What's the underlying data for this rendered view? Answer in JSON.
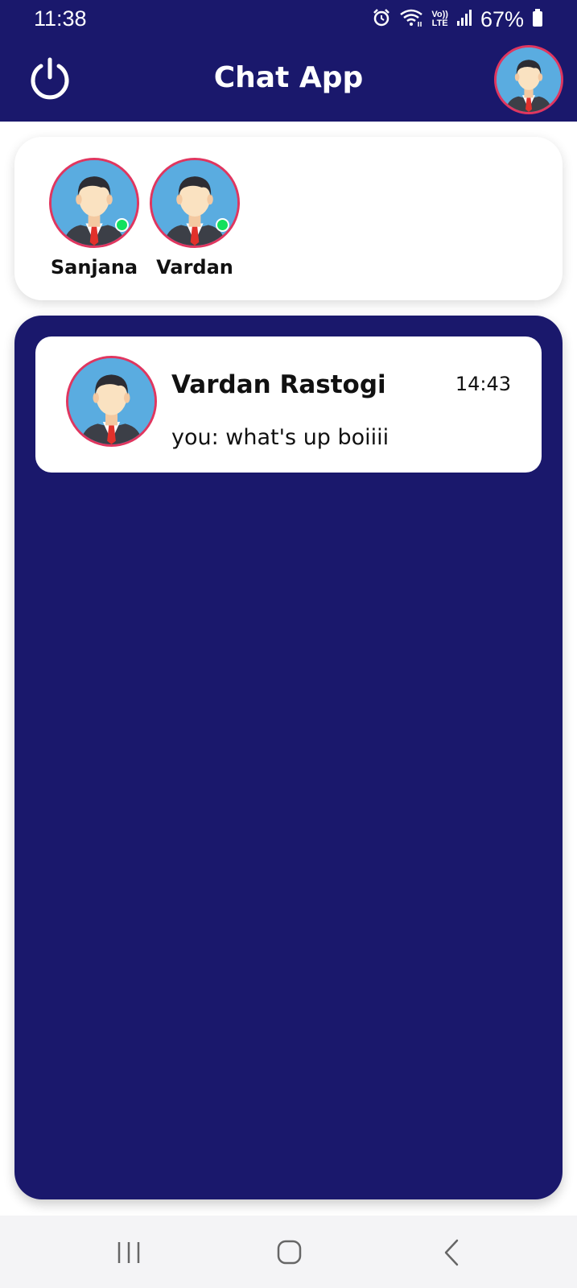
{
  "status_bar": {
    "time": "11:38",
    "battery_percent": "67%",
    "icons": [
      "alarm-icon",
      "wifi-icon",
      "volte-icon",
      "signal-icon",
      "battery-icon"
    ],
    "volte_label_top": "Vo))",
    "volte_label_bottom": "LTE"
  },
  "app_bar": {
    "title": "Chat App",
    "left_icon": "power-icon",
    "right_icon": "profile-avatar"
  },
  "online_users": [
    {
      "name": "Sanjana",
      "online": true
    },
    {
      "name": "Vardan",
      "online": true
    }
  ],
  "chats": [
    {
      "name": "Vardan Rastogi",
      "time": "14:43",
      "last_message": "you: what's up boiiii"
    }
  ],
  "nav_bar": {
    "buttons": [
      "recent-apps-icon",
      "home-icon",
      "back-icon"
    ]
  },
  "colors": {
    "primary": "#1a186c",
    "avatar_border": "#e0365f",
    "avatar_bg": "#5aace0",
    "online_dot": "#13e05e",
    "nav_bg": "#f4f4f6"
  }
}
